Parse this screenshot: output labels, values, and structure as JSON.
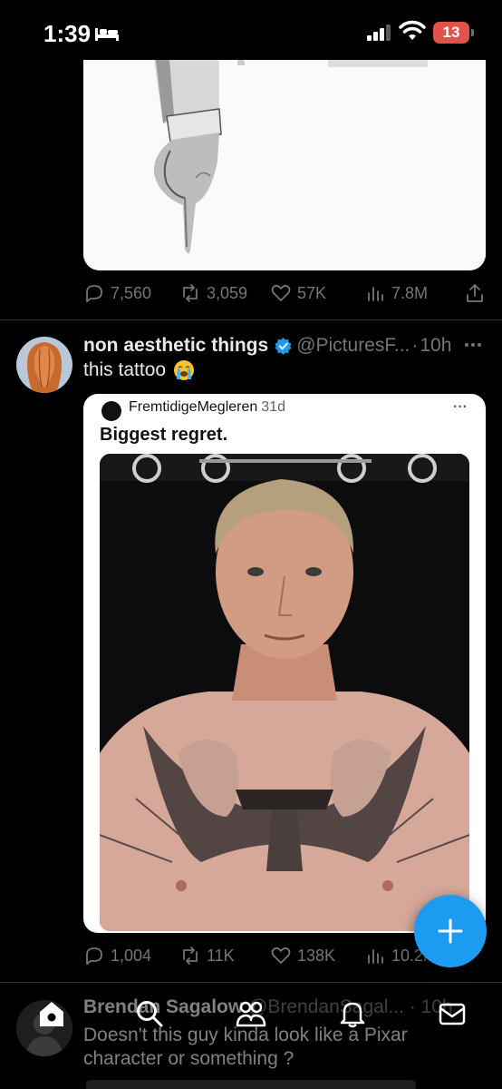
{
  "status_bar": {
    "time": "1:39",
    "battery": "13",
    "battery_color": "#e0524a"
  },
  "tweet_prev": {
    "actions": {
      "replies": "7,560",
      "reposts": "3,059",
      "likes": "57K",
      "views": "7.8M"
    }
  },
  "tweet": {
    "display_name": "non aesthetic things",
    "handle": "@PicturesF...",
    "separator": "·",
    "time": "10h",
    "text": "this tattoo",
    "emoji": "loudly-crying-face",
    "quote": {
      "author": "FremtidigeMegleren",
      "date": "31d",
      "more": "···",
      "text": "Biggest regret."
    },
    "actions": {
      "replies": "1,004",
      "reposts": "11K",
      "likes": "138K",
      "views": "10.2M"
    }
  },
  "tweet_next": {
    "display_name": "Brendan Sagalow",
    "handle": "@BrendanSagal...",
    "separator": "·",
    "time": "10h",
    "text": "Doesn't this guy kinda look like a Pixar character or something ?"
  },
  "tab_bar": {
    "tabs": [
      "home-icon",
      "search-icon",
      "communities-icon",
      "notifications-icon",
      "messages-icon"
    ]
  },
  "colors": {
    "accent": "#1d9bf0",
    "background": "#000000",
    "secondary_text": "#71767b"
  }
}
